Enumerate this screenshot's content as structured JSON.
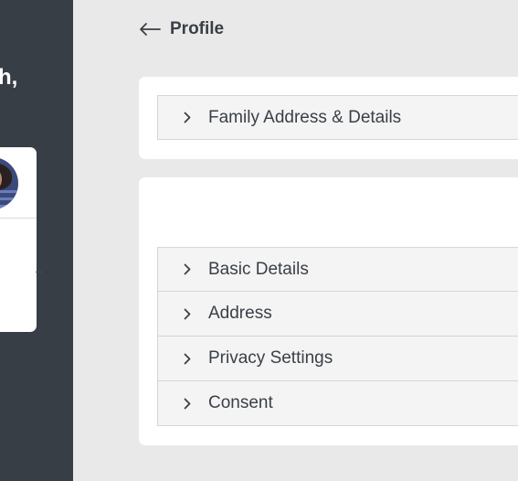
{
  "sidebar": {
    "greeting_fragment": "h,",
    "card_text_fragment": "..."
  },
  "header": {
    "back_label": "Profile",
    "back_icon": "arrow-left-icon"
  },
  "family_section": {
    "items": [
      {
        "label": "Family Address & Details",
        "icon": "chevron-right-icon"
      }
    ]
  },
  "profile_section": {
    "items": [
      {
        "label": "Basic Details",
        "icon": "chevron-right-icon"
      },
      {
        "label": "Address",
        "icon": "chevron-right-icon"
      },
      {
        "label": "Privacy Settings",
        "icon": "chevron-right-icon"
      },
      {
        "label": "Consent",
        "icon": "chevron-right-icon"
      }
    ]
  },
  "colors": {
    "sidebar_bg": "#373e46",
    "page_bg": "#e9e9e9",
    "card_bg": "#ffffff",
    "accordion_bg": "#f4f4f4",
    "text": "#3a3f47"
  }
}
